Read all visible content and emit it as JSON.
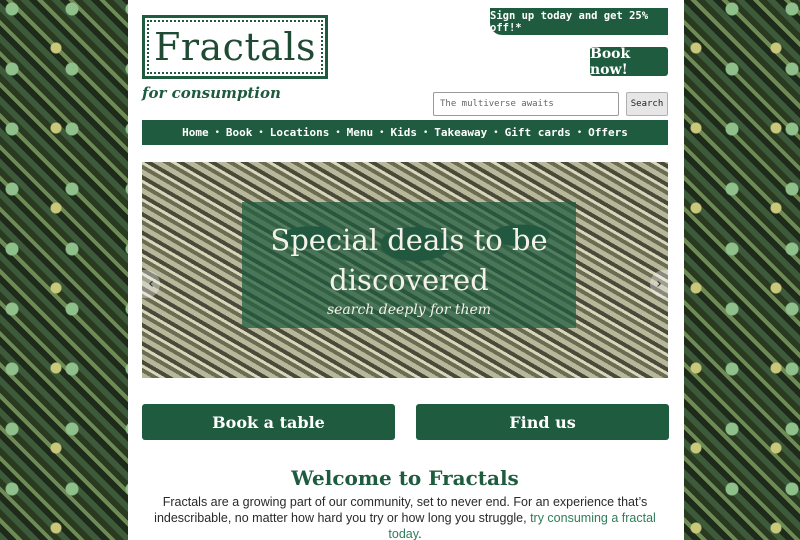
{
  "logo": {
    "text": "Fractals",
    "tagline": "for consumption"
  },
  "promo": {
    "label": "Sign up today and get 25% off!*"
  },
  "header": {
    "book_now_label": "Book now!"
  },
  "search": {
    "placeholder": "The multiverse awaits",
    "button_label": "Search"
  },
  "nav": {
    "items": [
      "Home",
      "Book",
      "Locations",
      "Menu",
      "Kids",
      "Takeaway",
      "Gift cards",
      "Offers"
    ]
  },
  "hero": {
    "title_line1": "Special deals to be",
    "title_line2": "discovered",
    "subtitle": "search deeply for them",
    "prev_icon": "chevron-left-icon",
    "next_icon": "chevron-right-icon"
  },
  "cta": {
    "book_label": "Book a table",
    "find_label": "Find us"
  },
  "welcome": {
    "heading": "Welcome to Fractals",
    "intro_text": "Fractals are a growing part of our community, set to never end. For an experience that’s indescribable, no matter how hard you try or how long you struggle, ",
    "intro_link": "try consuming a fractal today",
    "intro_end": "."
  },
  "colors": {
    "brand_green": "#1f5c3f",
    "link_green": "#2f7d5a",
    "background": "#ffffff"
  }
}
